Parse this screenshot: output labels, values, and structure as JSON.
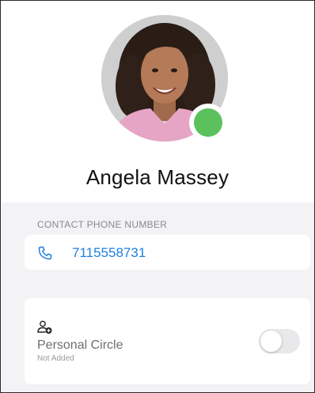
{
  "profile": {
    "name": "Angela Massey",
    "avatar_icon": "person-photo",
    "presence_status": "available",
    "presence_color": "#5bc15c"
  },
  "phone_section": {
    "label": "CONTACT PHONE NUMBER",
    "number": "7115558731",
    "icon": "phone-icon",
    "accent_color": "#1f7fe0"
  },
  "personal_circle": {
    "icon": "add-person-icon",
    "title": "Personal Circle",
    "status": "Not Added",
    "toggle_on": false
  }
}
